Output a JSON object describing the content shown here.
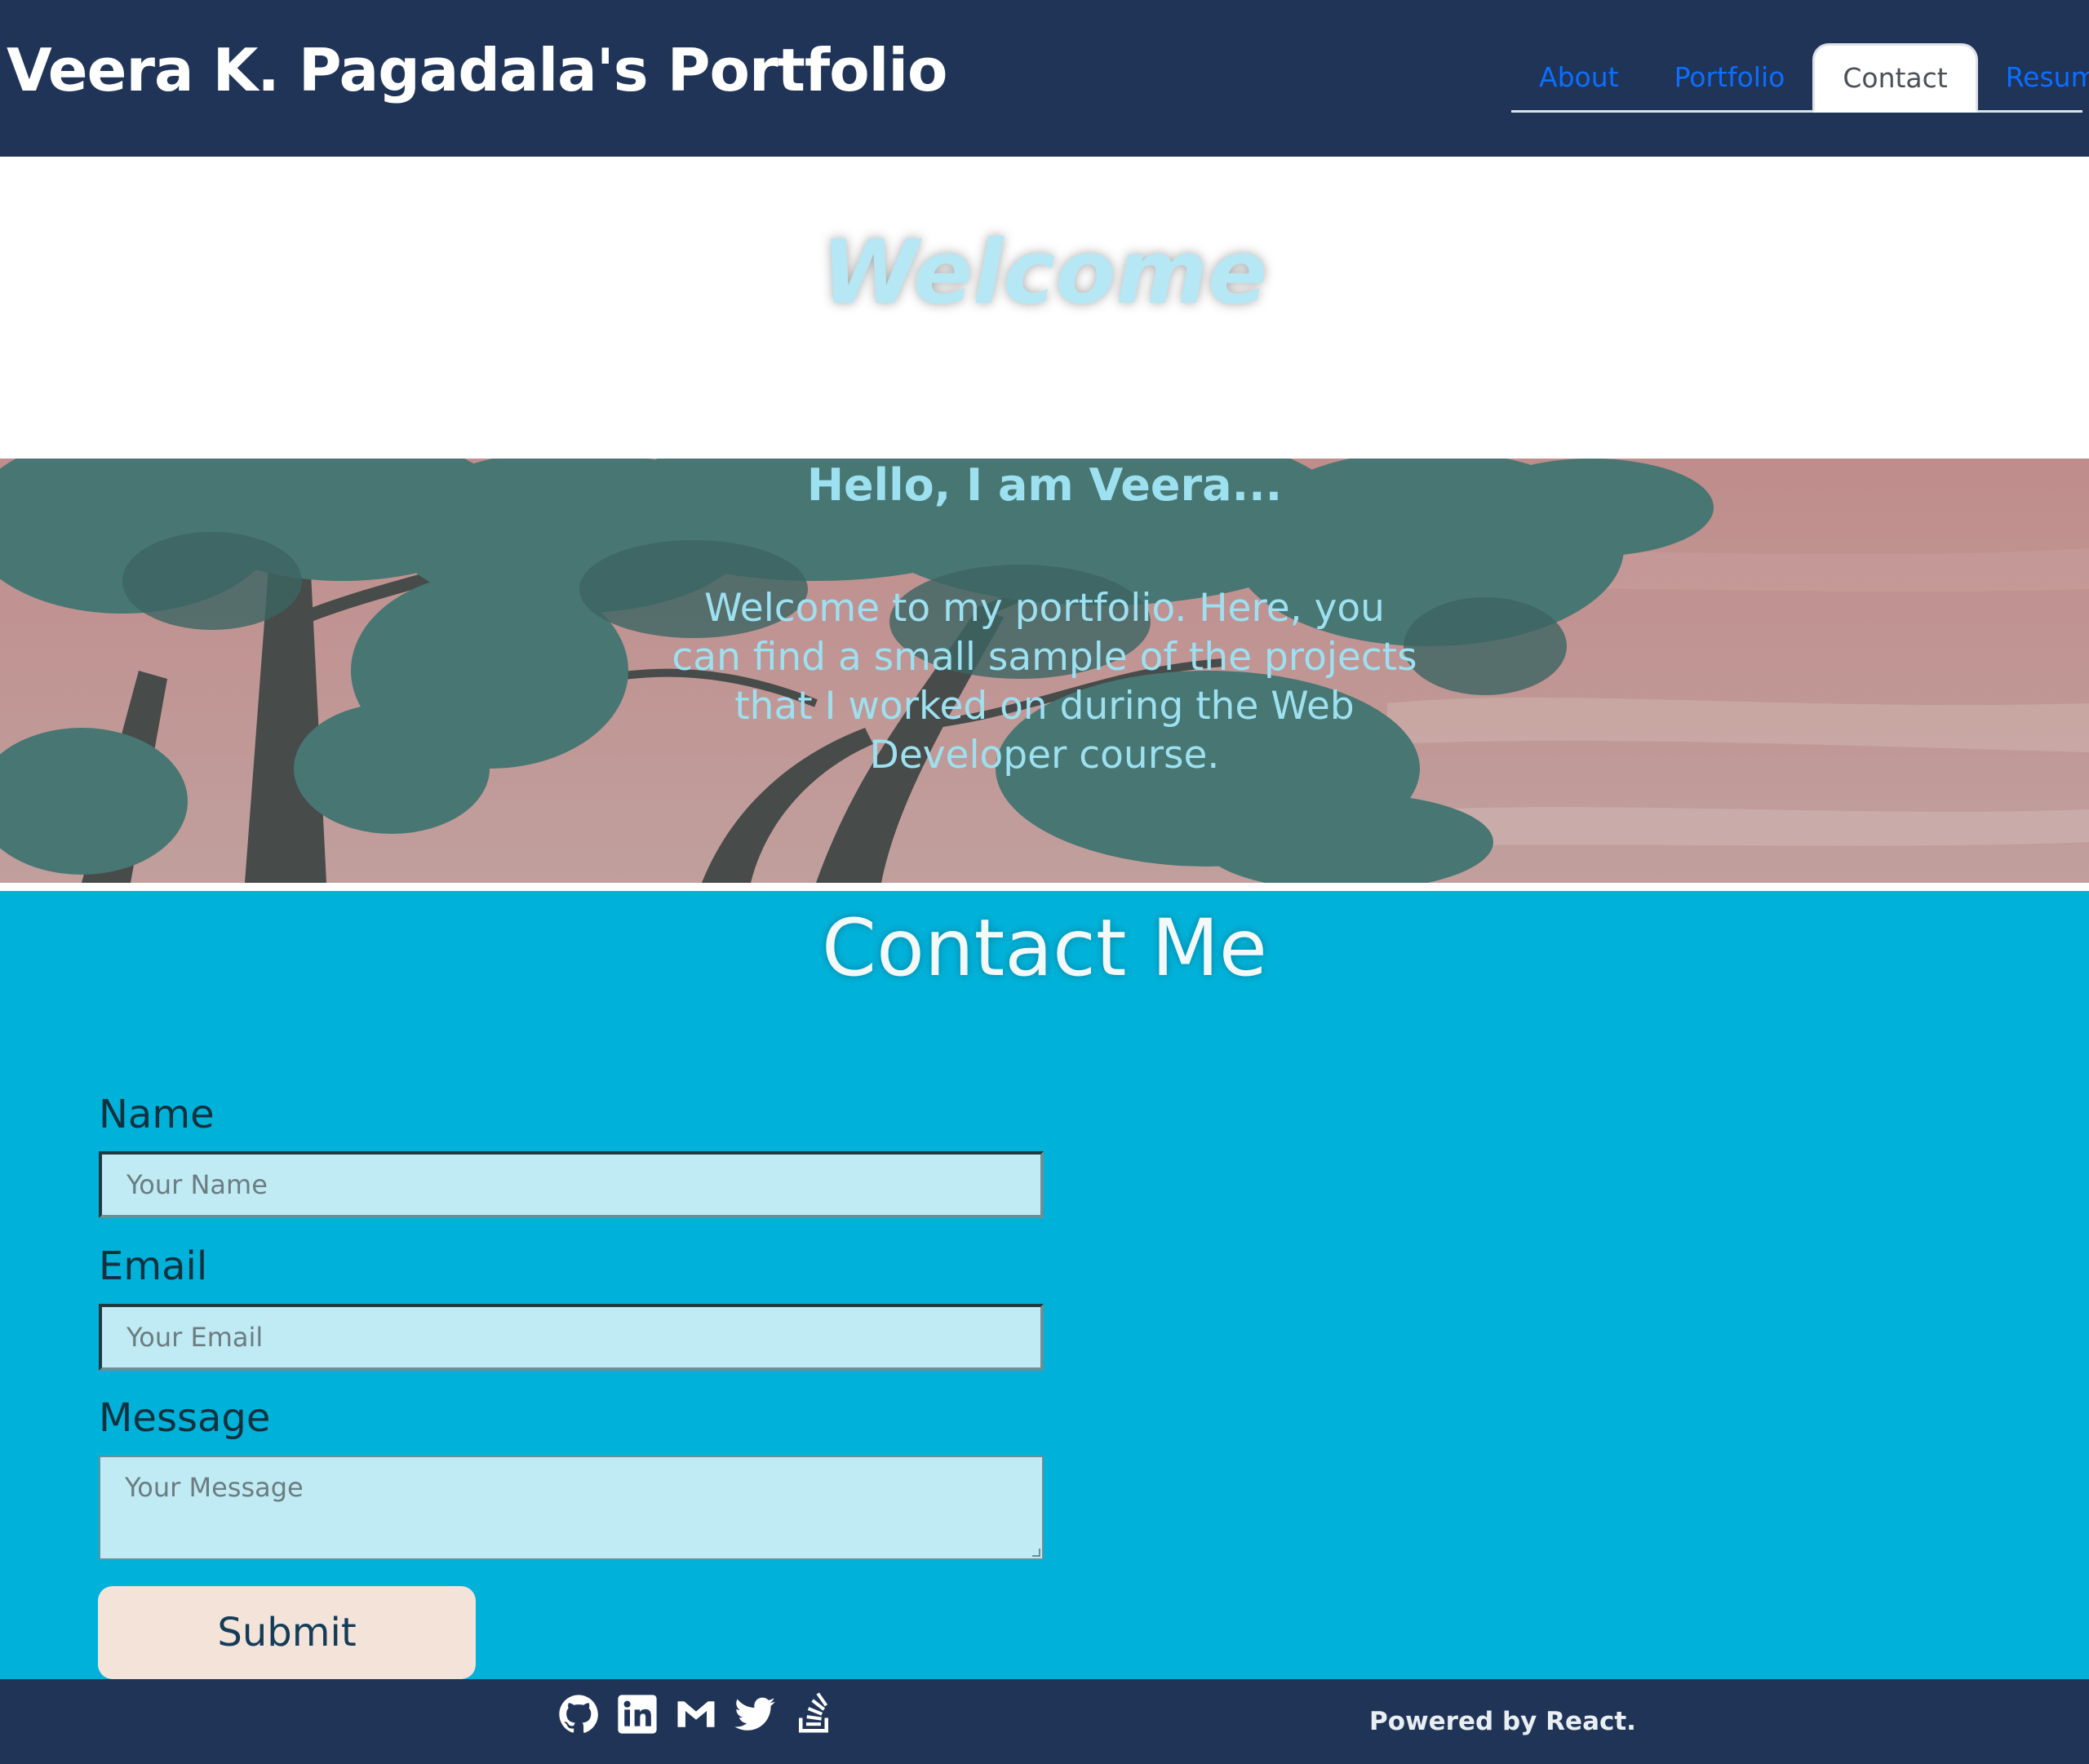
{
  "header": {
    "title": "Veera K. Pagadala's Portfolio",
    "nav": [
      {
        "label": "About",
        "active": false
      },
      {
        "label": "Portfolio",
        "active": false
      },
      {
        "label": "Contact",
        "active": true
      },
      {
        "label": "Resume",
        "active": false
      }
    ]
  },
  "welcome": {
    "title": "Welcome"
  },
  "hero": {
    "heading": "Hello, I am Veera...",
    "text": "Welcome to my portfolio. Here, you can find a small sample of the projects that I worked on during the Web Developer course."
  },
  "contact": {
    "title": "Contact Me",
    "name_label": "Name",
    "name_placeholder": "Your Name",
    "email_label": "Email",
    "email_placeholder": "Your Email",
    "message_label": "Message",
    "message_placeholder": "Your Message",
    "submit_label": "Submit"
  },
  "footer": {
    "icons": [
      "github-icon",
      "linkedin-icon",
      "gmail-icon",
      "twitter-icon",
      "stackoverflow-icon"
    ],
    "powered_by": "Powered by React."
  },
  "colors": {
    "header_bg": "#1f3457",
    "contact_bg": "#00b2d9",
    "field_bg": "#c0ebf4",
    "submit_bg": "#f3e3d8",
    "nav_link": "#0d6efd"
  }
}
